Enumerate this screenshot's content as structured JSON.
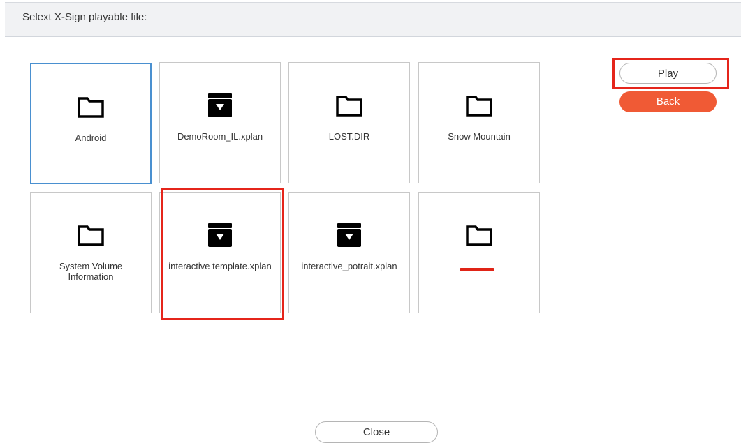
{
  "header": {
    "title": "Selext X-Sign playable file:"
  },
  "files": [
    {
      "label": "Android",
      "icon": "folder-icon",
      "kind": "folder"
    },
    {
      "label": "DemoRoom_IL.xplan",
      "icon": "xplan-file-icon",
      "kind": "xplan"
    },
    {
      "label": "LOST.DIR",
      "icon": "folder-icon",
      "kind": "folder"
    },
    {
      "label": "Snow Mountain",
      "icon": "folder-icon",
      "kind": "folder"
    },
    {
      "label": "System Volume\nInformation",
      "icon": "folder-icon",
      "kind": "folder"
    },
    {
      "label": "interactive template.xplan",
      "icon": "xplan-file-icon",
      "kind": "xplan"
    },
    {
      "label": "interactive_potrait.xplan",
      "icon": "xplan-file-icon",
      "kind": "xplan"
    },
    {
      "label": "",
      "icon": "folder-icon",
      "kind": "folder",
      "redacted": true
    }
  ],
  "buttons": {
    "play": "Play",
    "back": "Back",
    "close": "Close"
  },
  "colors": {
    "accent_orange": "#f05a35",
    "selection_blue": "#4a90d0",
    "annotation_red": "#e5251b"
  }
}
